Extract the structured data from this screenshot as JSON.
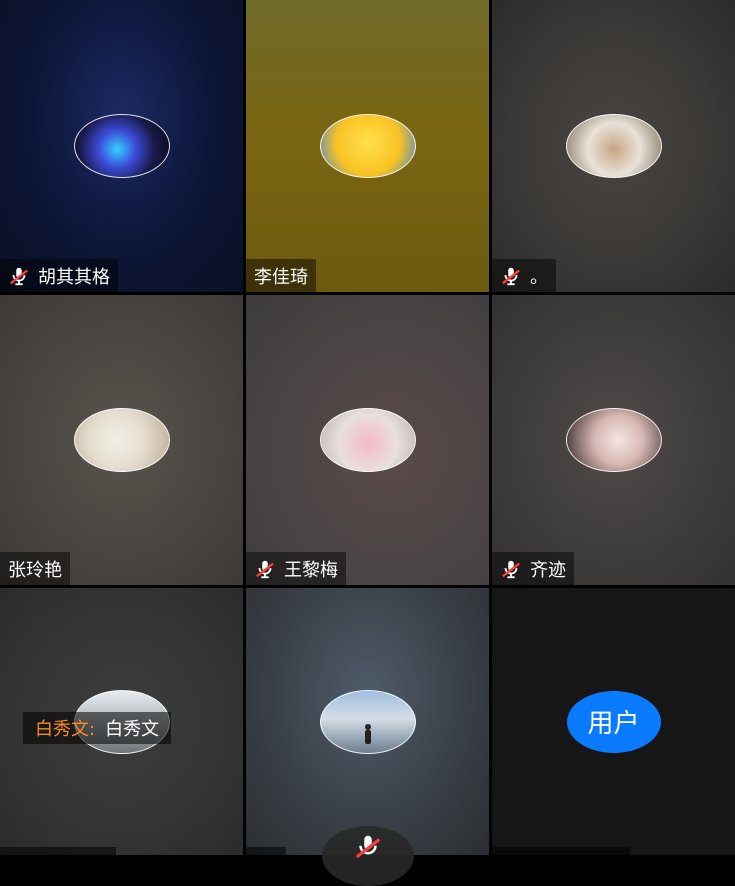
{
  "participants": [
    {
      "name": "胡其其格",
      "muted": true
    },
    {
      "name": "李佳琦",
      "muted": false
    },
    {
      "name": "。",
      "muted": true
    },
    {
      "name": "张玲艳",
      "muted": false
    },
    {
      "name": "王黎梅",
      "muted": true
    },
    {
      "name": "齐迹",
      "muted": true
    },
    {
      "name": "",
      "muted": false
    },
    {
      "name": "",
      "muted": false
    },
    {
      "name": "",
      "muted": false
    }
  ],
  "subtitle": {
    "speaker": "白秀文:",
    "text": "白秀文"
  },
  "placeholder_avatar": {
    "label": "用户",
    "color": "#0a7bff"
  },
  "colors": {
    "mute_icon": "#ffffff",
    "mute_slash": "#ff3b3b",
    "subtitle_speaker": "#ff8a1f"
  }
}
